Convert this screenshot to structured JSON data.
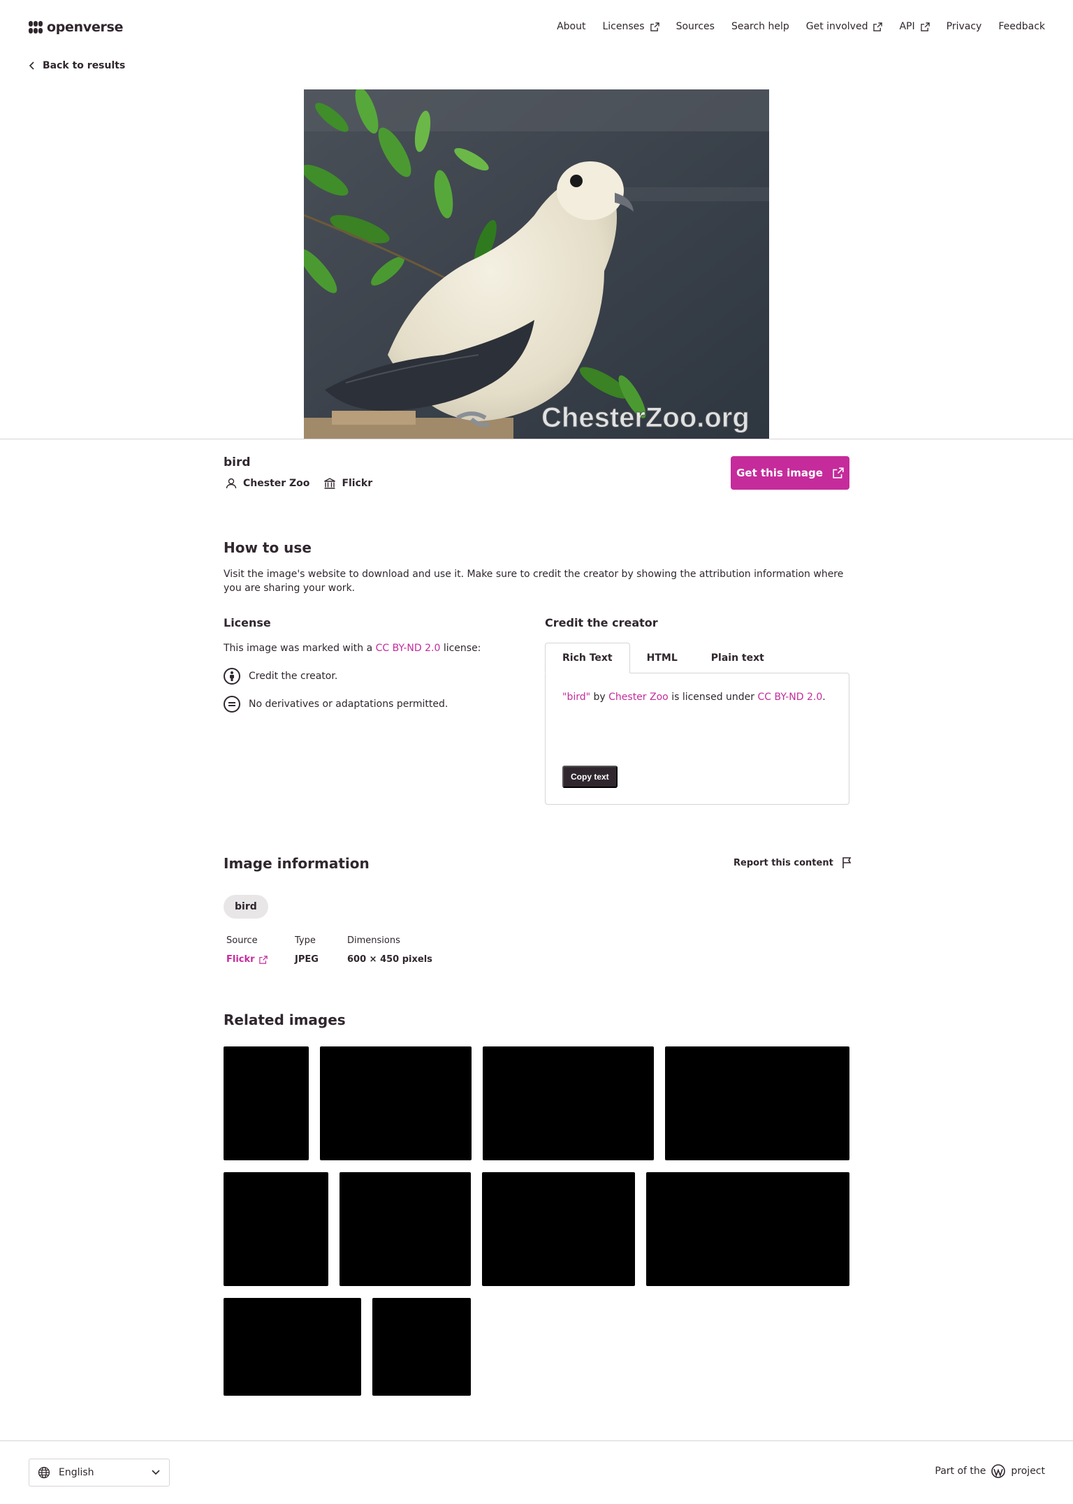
{
  "brand": {
    "name": "openverse"
  },
  "nav": [
    {
      "label": "About",
      "external": false
    },
    {
      "label": "Licenses",
      "external": true
    },
    {
      "label": "Sources",
      "external": false
    },
    {
      "label": "Search help",
      "external": false
    },
    {
      "label": "Get involved",
      "external": true
    },
    {
      "label": "API",
      "external": true
    },
    {
      "label": "Privacy",
      "external": false
    },
    {
      "label": "Feedback",
      "external": false
    }
  ],
  "back_label": "Back to results",
  "hero": {
    "watermark": "ChesterZoo.org"
  },
  "image": {
    "title": "bird",
    "creator": "Chester Zoo",
    "provider": "Flickr",
    "get_button": "Get this image"
  },
  "how_to_use": {
    "title": "How to use",
    "description": "Visit the image's website to download and use it. Make sure to credit the creator by showing the attribution information where you are sharing your work."
  },
  "license": {
    "title": "License",
    "prefix": "This image was marked with a",
    "name": "CC BY-ND 2.0",
    "suffix": "license:",
    "terms": [
      {
        "icon": "attribution-icon",
        "text": "Credit the creator."
      },
      {
        "icon": "no-derivatives-icon",
        "text": "No derivatives or adaptations permitted."
      }
    ]
  },
  "credit": {
    "title": "Credit the creator",
    "tabs": [
      "Rich Text",
      "HTML",
      "Plain text"
    ],
    "active_tab": "Rich Text",
    "attribution": {
      "title_quoted": "\"bird\"",
      "by": "by",
      "creator": "Chester Zoo",
      "licensed": "is licensed under",
      "license": "CC BY-ND 2.0",
      "end": "."
    },
    "copy_button": "Copy text"
  },
  "info": {
    "title": "Image information",
    "report": "Report this content",
    "tags": [
      "bird"
    ],
    "source_label": "Source",
    "source_value": "Flickr",
    "type_label": "Type",
    "type_value": "JPEG",
    "dimensions_label": "Dimensions",
    "dimensions_value": "600 × 450 pixels"
  },
  "related": {
    "title": "Related images",
    "count": 10
  },
  "footer": {
    "language": "English",
    "part_of": "Part of the",
    "project": "project"
  },
  "colors": {
    "accent": "#c52b9b",
    "text": "#30272e",
    "border": "#d8d4d7",
    "tag_bg": "#e9e6e8"
  }
}
